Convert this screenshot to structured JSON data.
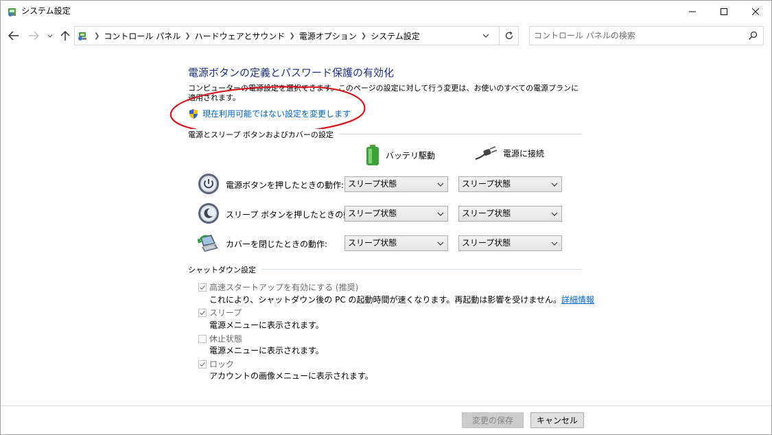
{
  "window": {
    "title": "システム設定"
  },
  "address": {
    "crumbs": [
      "コントロール パネル",
      "ハードウェアとサウンド",
      "電源オプション",
      "システム設定"
    ],
    "search_placeholder": "コントロール パネルの検索"
  },
  "page": {
    "heading": "電源ボタンの定義とパスワード保護の有効化",
    "description": "コンピューターの電源設定を選択できます。このページの設定に対して行う変更は、お使いのすべての電源プランに適用されます。",
    "uac_link": "現在利用可能ではない設定を変更します"
  },
  "buttons_section": {
    "title": "電源とスリープ ボタンおよびカバーの設定",
    "col_battery": "バッテリ駆動",
    "col_plugged": "電源に接続",
    "rows": [
      {
        "label": "電源ボタンを押したときの動作:",
        "battery": "スリープ状態",
        "plugged": "スリープ状態"
      },
      {
        "label": "スリープ ボタンを押したときの動作:",
        "battery": "スリープ状態",
        "plugged": "スリープ状態"
      },
      {
        "label": "カバーを閉じたときの動作:",
        "battery": "スリープ状態",
        "plugged": "スリープ状態"
      }
    ]
  },
  "shutdown_section": {
    "title": "シャットダウン設定",
    "items": [
      {
        "label": "高速スタートアップを有効にする (推奨)",
        "desc": "これにより、シャットダウン後の PC の起動時間が速くなります。再起動は影響を受けません。",
        "link": "詳細情報",
        "checked": true
      },
      {
        "label": "スリープ",
        "desc": "電源メニューに表示されます。",
        "checked": true
      },
      {
        "label": "休止状態",
        "desc": "電源メニューに表示されます。",
        "checked": false
      },
      {
        "label": "ロック",
        "desc": "アカウントの画像メニューに表示されます。",
        "checked": true
      }
    ]
  },
  "footer": {
    "save_label": "変更の保存",
    "cancel_label": "キャンセル"
  },
  "colors": {
    "heading": "#1e3287",
    "link": "#0066cc",
    "annotation": "#d8141e"
  }
}
